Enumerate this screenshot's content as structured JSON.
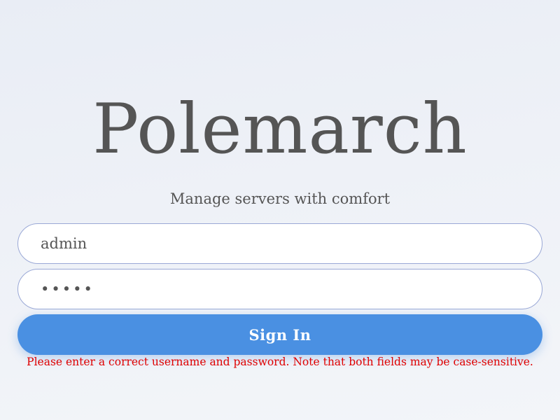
{
  "app": {
    "title": "Polemarch",
    "subtitle": "Manage servers with comfort"
  },
  "login": {
    "username_value": "admin",
    "password_value": "•••••",
    "sign_in_label": "Sign In",
    "error_message": "Please enter a correct username and password. Note that both fields may be case-sensitive."
  },
  "colors": {
    "accent": "#4a90e2",
    "error": "#e00000",
    "text": "#555555",
    "field_border": "#9aa8d6"
  }
}
